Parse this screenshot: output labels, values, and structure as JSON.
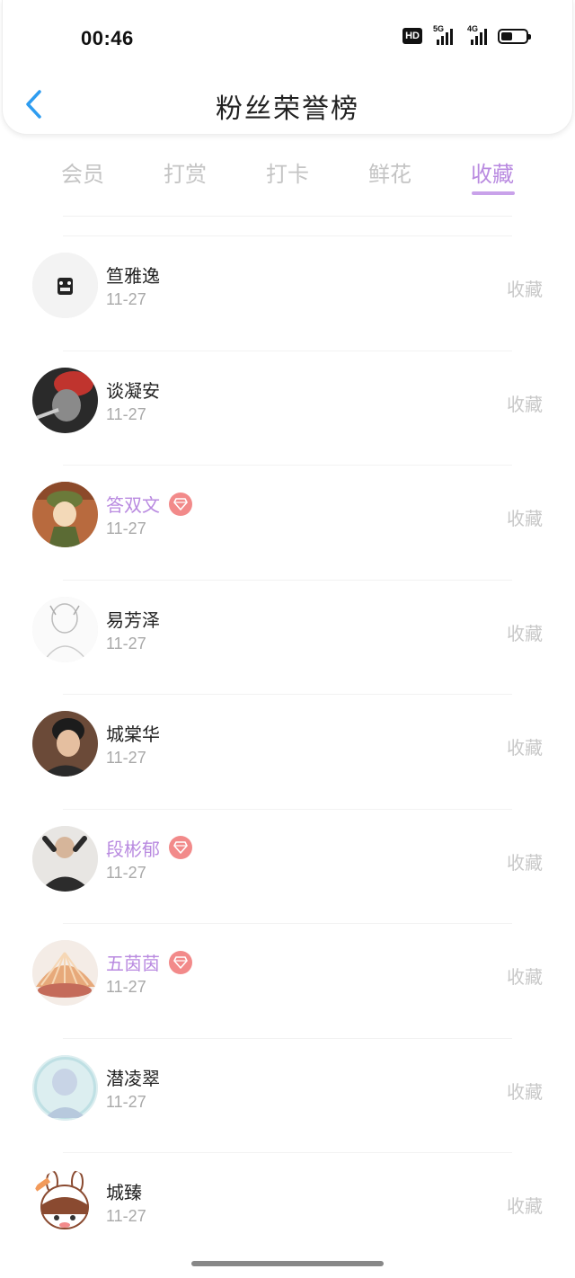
{
  "status_bar": {
    "time": "00:46",
    "hd_label": "HD",
    "network_1": "5G",
    "network_2": "4G",
    "battery_level": 0.45
  },
  "header": {
    "title": "粉丝荣誉榜",
    "back_icon": "chevron-left-icon"
  },
  "tabs": [
    {
      "label": "会员",
      "active": false
    },
    {
      "label": "打赏",
      "active": false
    },
    {
      "label": "打卡",
      "active": false
    },
    {
      "label": "鲜花",
      "active": false
    },
    {
      "label": "收藏",
      "active": true
    }
  ],
  "accent_color": "#b98ae0",
  "badge_color": "#f28a8a",
  "fans": [
    {
      "name": "笪雅逸",
      "date": "11-27",
      "vip": false,
      "action": "收藏"
    },
    {
      "name": "谈凝安",
      "date": "11-27",
      "vip": false,
      "action": "收藏"
    },
    {
      "name": "答双文",
      "date": "11-27",
      "vip": true,
      "action": "收藏"
    },
    {
      "name": "易芳泽",
      "date": "11-27",
      "vip": false,
      "action": "收藏"
    },
    {
      "name": "城棠华",
      "date": "11-27",
      "vip": false,
      "action": "收藏"
    },
    {
      "name": "段彬郁",
      "date": "11-27",
      "vip": true,
      "action": "收藏"
    },
    {
      "name": "五茵茵",
      "date": "11-27",
      "vip": true,
      "action": "收藏"
    },
    {
      "name": "潜凌翠",
      "date": "11-27",
      "vip": false,
      "action": "收藏"
    },
    {
      "name": "城臻",
      "date": "11-27",
      "vip": false,
      "action": "收藏"
    }
  ]
}
